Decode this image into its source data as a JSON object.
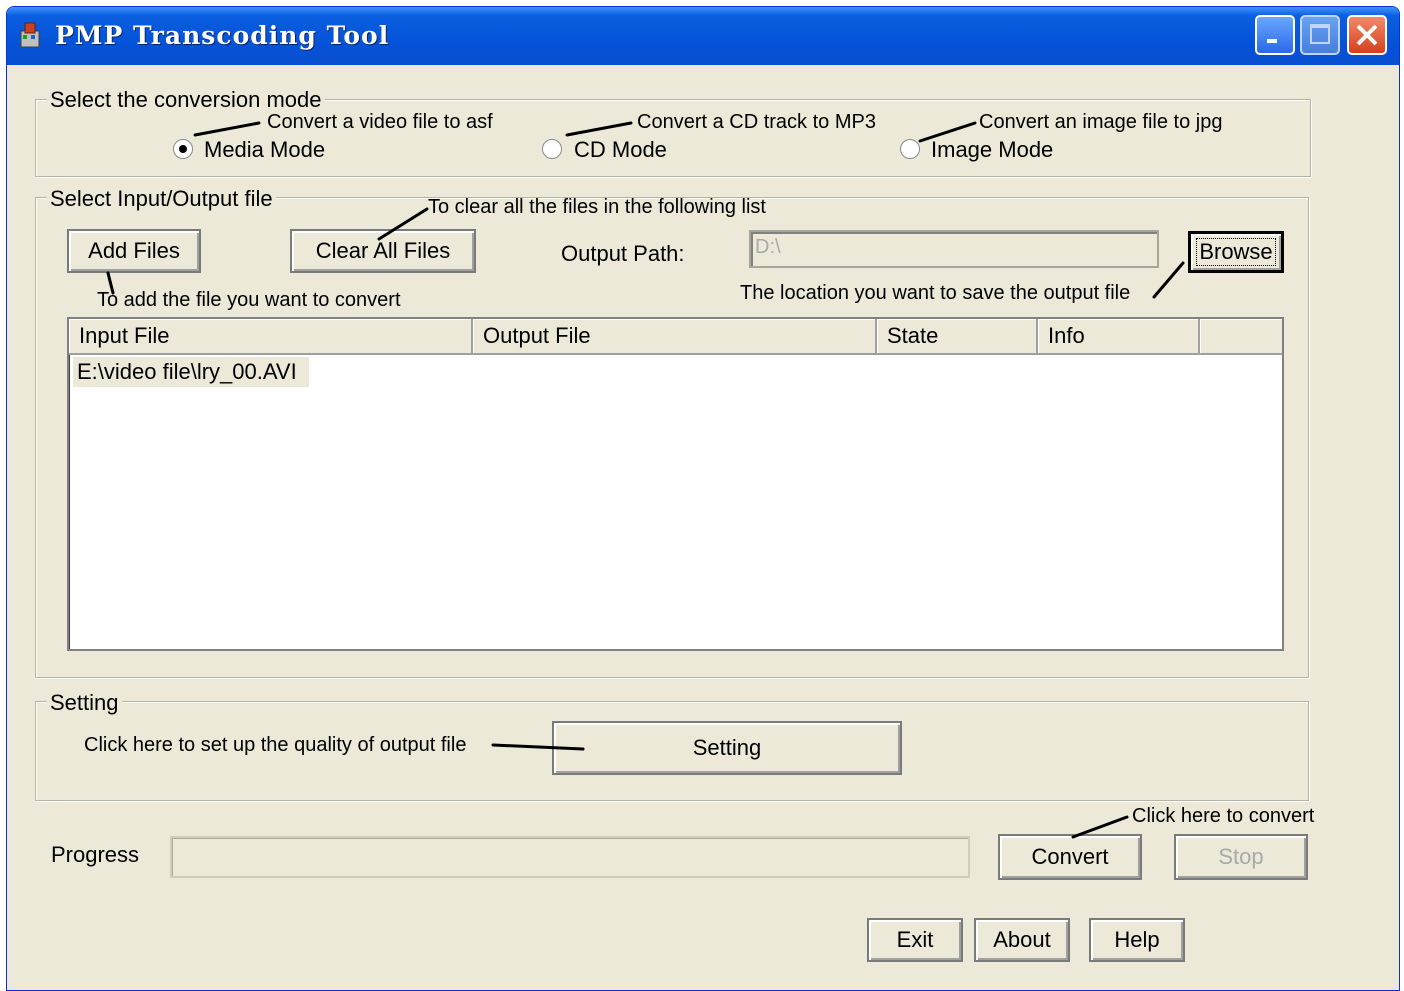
{
  "window": {
    "title": "PMP Transcoding Tool"
  },
  "mode_group": {
    "legend": "Select the conversion  mode",
    "options": [
      {
        "label": "Media Mode",
        "selected": true,
        "annotation": "Convert a video file to asf"
      },
      {
        "label": "CD Mode",
        "selected": false,
        "annotation": "Convert a CD track to MP3"
      },
      {
        "label": "Image Mode",
        "selected": false,
        "annotation": "Convert an image file to jpg"
      }
    ]
  },
  "io_group": {
    "legend": "Select Input/Output file",
    "add_files_label": "Add Files",
    "add_files_annotation": "To add the file you want to convert",
    "clear_all_label": "Clear All Files",
    "clear_all_annotation": "To clear all the files in the following list",
    "output_path_label": "Output Path:",
    "output_path_value": "D:\\",
    "browse_label": "Browse",
    "browse_annotation": "The location you want to save the output file",
    "columns": [
      "Input File",
      "Output File",
      "State",
      "Info"
    ],
    "rows": [
      {
        "input_file": "E:\\video file\\lry_00.AVI",
        "output_file": "",
        "state": "",
        "info": ""
      }
    ]
  },
  "setting_group": {
    "legend": "Setting",
    "annotation": "Click here to set up the quality of output file",
    "button_label": "Setting"
  },
  "progress": {
    "label": "Progress",
    "value": 0
  },
  "actions": {
    "convert_label": "Convert",
    "convert_annotation": "Click here to convert",
    "stop_label": "Stop",
    "exit_label": "Exit",
    "about_label": "About",
    "help_label": "Help"
  },
  "colors": {
    "titlebar": "#0553d8",
    "window_bg": "#ece9d8",
    "close_button": "#d7401c"
  }
}
